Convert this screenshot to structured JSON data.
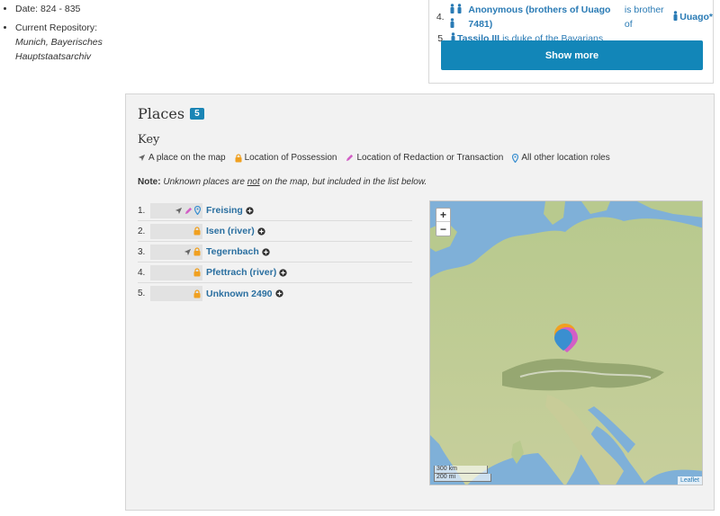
{
  "meta": {
    "date_label": "Date:",
    "date_value": "824 - 835",
    "repo_label": "Current Repository:",
    "repo_value": "Munich, Bayerisches Hauptstaatsarchiv"
  },
  "people": {
    "items": [
      {
        "num": "4.",
        "name": "Anonymous (brothers of Uuago 7481)",
        "relation": "is brother of",
        "target": "Uuago*",
        "icon_count": 3
      },
      {
        "num": "5.",
        "name": "Tassilo III",
        "relation": "is duke of the Bavarians",
        "target": "",
        "icon_count": 1
      }
    ],
    "show_more_label": "Show more"
  },
  "places": {
    "title": "Places",
    "count": "5",
    "key_title": "Key",
    "key_items": [
      {
        "icon": "arrow-icon",
        "label": "A place on the map"
      },
      {
        "icon": "lock-icon",
        "label": "Location of Possession"
      },
      {
        "icon": "pencil-icon",
        "label": "Location of Redaction or Transaction"
      },
      {
        "icon": "marker-icon",
        "label": "All other location roles"
      }
    ],
    "note_label": "Note:",
    "note_text_1": "Unknown places are",
    "note_not": "not",
    "note_text_2": "on the map, but included in the list below.",
    "list": [
      {
        "num": "1.",
        "name": "Freising",
        "icons": [
          "arrow-icon",
          "pencil-icon",
          "marker-icon"
        ]
      },
      {
        "num": "2.",
        "name": "Isen (river)",
        "icons": [
          "lock-icon"
        ]
      },
      {
        "num": "3.",
        "name": "Tegernbach",
        "icons": [
          "arrow-icon",
          "lock-icon"
        ]
      },
      {
        "num": "4.",
        "name": "Pfettrach (river)",
        "icons": [
          "lock-icon"
        ]
      },
      {
        "num": "5.",
        "name": "Unknown 2490",
        "icons": [
          "lock-icon"
        ]
      }
    ]
  },
  "map": {
    "zoom_in": "+",
    "zoom_out": "−",
    "scale_km": "300 km",
    "scale_mi": "200 mi",
    "attribution": "Leaflet"
  },
  "colors": {
    "accent": "#1286b8",
    "link": "#2a7bb5",
    "lock": "#f0a020",
    "pencil": "#d25fc6",
    "marker": "#3a8fd0",
    "arrow": "#666666"
  }
}
